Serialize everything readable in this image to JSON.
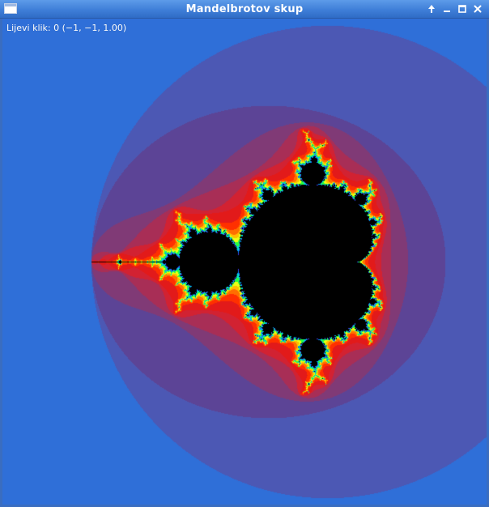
{
  "window": {
    "title": "Mandelbrotov skup",
    "status_text": "Lijevi klik: 0 (−1, −1, 1.00)",
    "icons": {
      "app": "window-app-icon",
      "up": "arrow-up-icon",
      "minimize": "minimize-icon",
      "maximize": "maximize-icon",
      "close": "close-icon"
    }
  },
  "fractal": {
    "center": [
      -0.7,
      0.0
    ],
    "max_iterations": 60,
    "colors": {
      "set": "#000000",
      "outer_blue": "#2f6fd8",
      "violet": "#4c58b4",
      "band_red": "#e21a1a",
      "accent_yellow": "#ffe000",
      "accent_green": "#20ff40"
    }
  }
}
